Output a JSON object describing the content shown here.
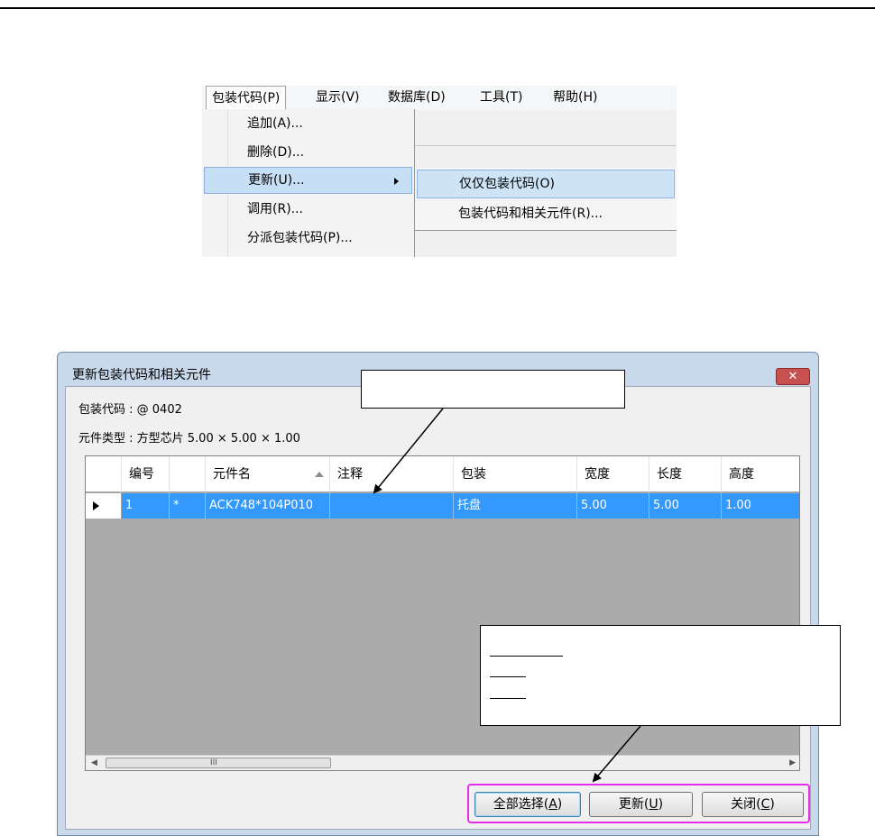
{
  "menu": {
    "bar": [
      "包装代码(P)",
      "显示(V)",
      "数据库(D)",
      "工具(T)",
      "帮助(H)"
    ],
    "dropdown": [
      "追加(A)...",
      "删除(D)...",
      "更新(U)...",
      "调用(R)...",
      "分派包装代码(P)..."
    ],
    "submenu": [
      "仅仅包装代码(O)",
      "包装代码和相关元件(R)..."
    ]
  },
  "dialog": {
    "title": "更新包装代码和相关元件",
    "close": "✕",
    "package_code": "包装代码 : @ 0402",
    "component_type": "元件类型 : 方型芯片  5.00 × 5.00 × 1.00",
    "columns": [
      "编号",
      "",
      "元件名",
      "注释",
      "包装",
      "宽度",
      "长度",
      "高度"
    ],
    "row": [
      "1",
      "*",
      "ACK748*104P010",
      "",
      "托盘",
      "5.00",
      "5.00",
      "1.00"
    ],
    "scroll_grip": "III",
    "buttons": {
      "select_all": "全部选择(",
      "select_all_key": "A",
      "update": "更新(",
      "update_key": "U",
      "close": "关闭(",
      "close_key": "C",
      "paren": ")"
    }
  },
  "colors": {
    "highlight": "#3399ff",
    "frame": "#e62ee6"
  }
}
